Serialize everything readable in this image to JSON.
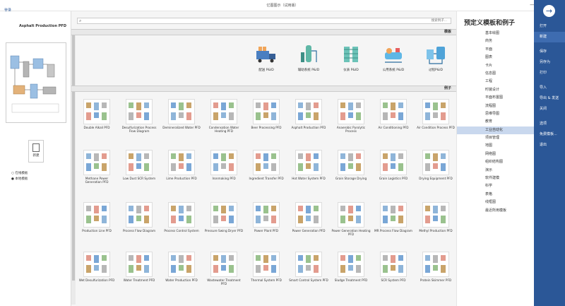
{
  "window": {
    "title": "亿图图示（试用版）",
    "login": "登录",
    "controls": [
      "—",
      "☐",
      "✕"
    ]
  },
  "nav": {
    "items": [
      "打开",
      "新建",
      "保存",
      "另存为",
      "打印",
      "导入",
      "导出 & 发送",
      "关闭",
      "选项",
      "免费模板...",
      "退出"
    ],
    "active_index": 1
  },
  "categories": {
    "heading": "预定义模板和例子",
    "items": [
      "基本绘图",
      "商务",
      "平面",
      "图表",
      "卡片",
      "信息图",
      "工程",
      "时装设计",
      "平面布置图",
      "流程图",
      "思维导图",
      "教育",
      "工业自动化",
      "项目管理",
      "地图",
      "网络图",
      "组织结构图",
      "演示",
      "软件建模",
      "科学",
      "表格",
      "线框图",
      "最近所用模板"
    ],
    "active_index": 12
  },
  "main": {
    "search_placeholder": "搜索例子...",
    "templates_header": "模板",
    "examples_header": "例子",
    "templates": [
      {
        "label": "过程P&ID",
        "icon": "process-pid-icon"
      },
      {
        "label": "公用系统 P&ID",
        "icon": "utility-pid-icon"
      },
      {
        "label": "仪表 P&ID",
        "icon": "instrument-pid-icon"
      },
      {
        "label": "辅助系统 P&ID",
        "icon": "auxiliary-pid-icon"
      },
      {
        "label": "配送 P&ID",
        "icon": "delivery-truck-icon"
      }
    ],
    "examples": [
      [
        "Air Condition Process PFD",
        "Air Conditioning PFD",
        "Anaerobic Pyrolytic Process",
        "Asphalt Production PFD",
        "Beer Processing PFD",
        "Condensation Water Heating PFD",
        "Demineralized Water PFD",
        "Desulfurization Process Flow Diagram",
        "Double Alkali PFD"
      ],
      [
        "Drying Equipment PFD",
        "Grain Logistics PFD",
        "Grain Storage Drying",
        "Hot Water System PFD",
        "Ingredient Transfer PFD",
        "Ironmaking PFD",
        "Lime Production PFD",
        "Low Dust SCR System",
        "Methane Power Generation PFD"
      ],
      [
        "Methyl Production PFD",
        "MR Process Flow Diagram",
        "Power Generation Heating PFD",
        "Power Generation PFD",
        "Power Plant PFD",
        "Pressure Swing Dryer PFD",
        "Process Control System",
        "Process Flow Diagram",
        "Production Line PFD"
      ],
      [
        "Protein Skimmer PFD",
        "SCR System PFD",
        "Sludge Treatment PFD",
        "Smart Control System PFD",
        "Thermal System PFD",
        "Wastewater Treatment PFD",
        "Water Production PFD",
        "Water Treatment PFD",
        "Wet Desulfurization PFD"
      ]
    ]
  },
  "preview": {
    "title": "Asphalt Production PFD",
    "new_button": "新建",
    "options": [
      "在线模板",
      "本地模板"
    ]
  },
  "colors": {
    "nav_bg": "#2b5797",
    "active_category": "#c9d8ee",
    "thumb_blue": "#7aa7d6"
  }
}
